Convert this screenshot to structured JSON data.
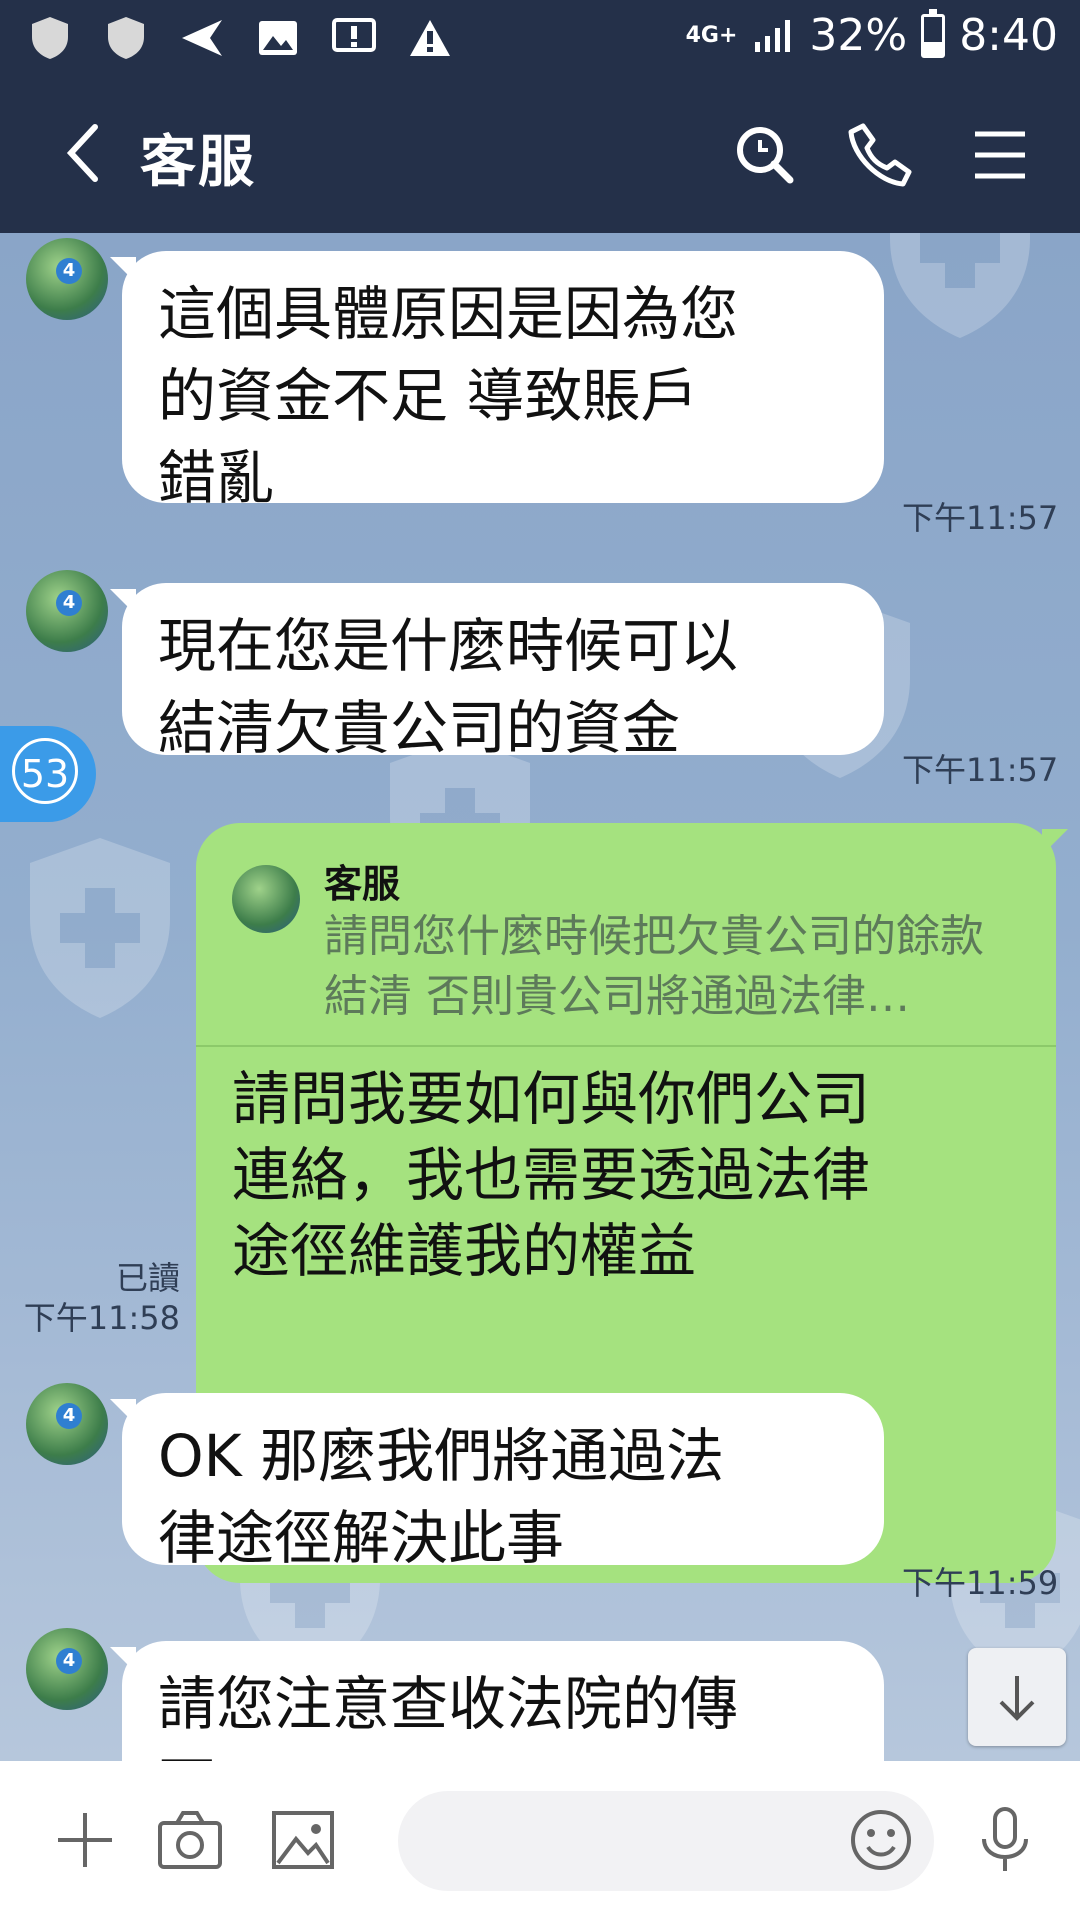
{
  "status_bar": {
    "network": "4G+",
    "battery_percent": "32%",
    "time": "8:40",
    "battery_level": 0.32
  },
  "header": {
    "title": "客服",
    "icons": [
      "back-arrow-icon",
      "search-icon",
      "phone-icon",
      "menu-icon"
    ]
  },
  "unread_badge": "53",
  "messages": [
    {
      "side": "in",
      "text": "這個具體原因是因為您\n的資金不足  導致賬戶\n錯亂",
      "time": "下午11:57"
    },
    {
      "side": "in",
      "text": "現在您是什麼時候可以\n結清欠貴公司的資金",
      "time": "下午11:57"
    },
    {
      "side": "out",
      "quote_name": "客服",
      "quote_text": "請問您什麼時候把欠貴公司的餘款結清  否則貴公司將通過法律…",
      "text": "請問我要如何與你們公司\n連絡，我也需要透過法律\n途徑維護我的權益",
      "read": "已讀",
      "time": "下午11:58"
    },
    {
      "side": "in",
      "text": "OK  那麼我們將通過法\n律途徑解決此事",
      "time": "下午11:59"
    },
    {
      "side": "in",
      "text": "請您注意查收法院的傳\n票"
    }
  ],
  "composer": {
    "icons": [
      "plus-icon",
      "camera-icon",
      "image-icon",
      "emoji-icon",
      "microphone-icon"
    ],
    "placeholder": ""
  },
  "colors": {
    "header_bg": "#243049",
    "chat_bg": "#8ea7c7",
    "incoming_bubble": "#ffffff",
    "outgoing_bubble": "#a5e27f",
    "unread_badge": "#3b9be8"
  }
}
